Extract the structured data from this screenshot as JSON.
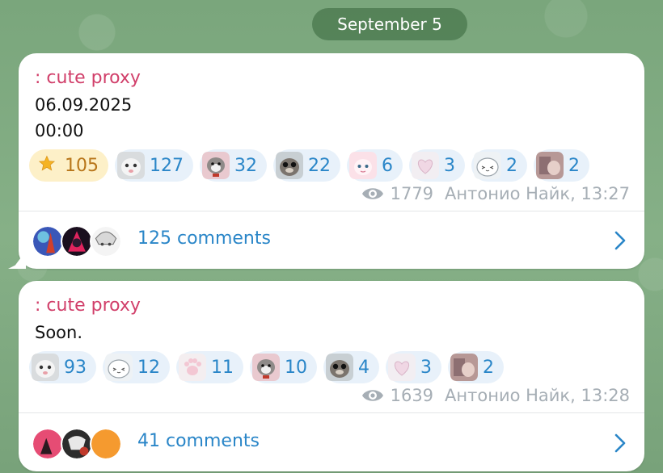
{
  "date_divider": "September 5",
  "posts": [
    {
      "author": ": cute proxy",
      "lines": [
        "06.09.2025",
        "00:00"
      ],
      "reactions": [
        {
          "icon": "star-icon",
          "count": "105"
        },
        {
          "icon": "white-cat-sticker-icon",
          "count": "127"
        },
        {
          "icon": "cat-bow-sticker-icon",
          "count": "32"
        },
        {
          "icon": "hamster-sticker-icon",
          "count": "22"
        },
        {
          "icon": "pink-bunny-sticker-icon",
          "count": "6"
        },
        {
          "icon": "heart-sticker-icon",
          "count": "3"
        },
        {
          "icon": "fluffy-cat-sticker-icon",
          "count": "2"
        },
        {
          "icon": "photo-sticker-icon",
          "count": "2"
        }
      ],
      "views": "1779",
      "signature": "Антонио Найк, 13:27",
      "comments": "125 comments"
    },
    {
      "author": ": cute proxy",
      "lines": [
        "Soon."
      ],
      "reactions": [
        {
          "icon": "white-cat-sticker-icon",
          "count": "93"
        },
        {
          "icon": "fluffy-cat-sticker-icon",
          "count": "12"
        },
        {
          "icon": "paw-sticker-icon",
          "count": "11"
        },
        {
          "icon": "cat-bow-sticker-icon",
          "count": "10"
        },
        {
          "icon": "hamster-sticker-icon",
          "count": "4"
        },
        {
          "icon": "heart-sticker-icon",
          "count": "3"
        },
        {
          "icon": "photo-sticker-icon",
          "count": "2"
        }
      ],
      "views": "1639",
      "signature": "Антонио Найк, 13:28",
      "comments": "41 comments"
    }
  ],
  "colors": {
    "author": "#d13f6a",
    "link": "#2a86c8",
    "reaction_bg": "#e8f1fa",
    "star_reaction_bg": "#fdf0c8",
    "star_count": "#b8761a",
    "meta": "#a6aeb5"
  }
}
